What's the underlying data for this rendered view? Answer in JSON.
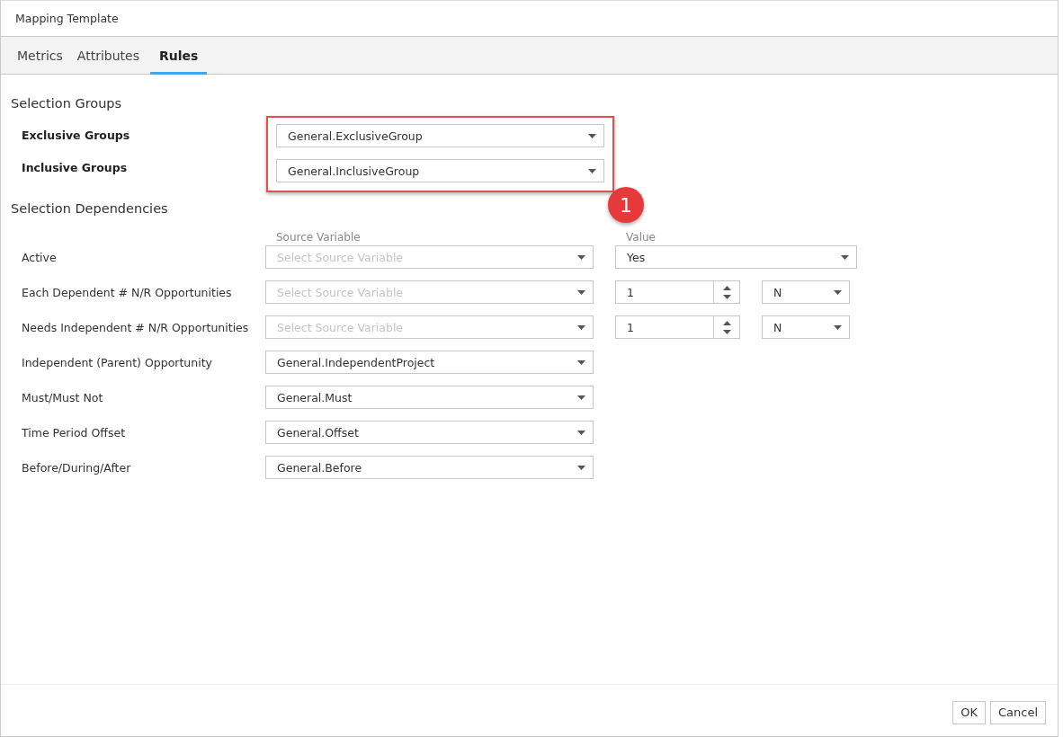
{
  "window": {
    "title": "Mapping Template"
  },
  "tabs": [
    {
      "label": "Metrics",
      "selected": false
    },
    {
      "label": "Attributes",
      "selected": false
    },
    {
      "label": "Rules",
      "selected": true
    }
  ],
  "selection_groups": {
    "heading": "Selection Groups",
    "callout": "1",
    "rows": [
      {
        "label": "Exclusive Groups",
        "value": "General.ExclusiveGroup"
      },
      {
        "label": "Inclusive Groups",
        "value": "General.InclusiveGroup"
      }
    ]
  },
  "selection_dependencies": {
    "heading": "Selection Dependencies",
    "column_headers": {
      "source": "Source Variable",
      "value": "Value"
    },
    "rows": [
      {
        "kind": "select-value",
        "label": "Active",
        "source_placeholder": "Select Source Variable",
        "value": "Yes"
      },
      {
        "kind": "spin-unit",
        "label": "Each Dependent # N/R Opportunities",
        "source_placeholder": "Select Source Variable",
        "number": "1",
        "unit": "N"
      },
      {
        "kind": "spin-unit",
        "label": "Needs Independent # N/R Opportunities",
        "source_placeholder": "Select Source Variable",
        "number": "1",
        "unit": "N"
      },
      {
        "kind": "source",
        "label": "Independent (Parent) Opportunity",
        "source": "General.IndependentProject"
      },
      {
        "kind": "source",
        "label": "Must/Must Not",
        "source": "General.Must"
      },
      {
        "kind": "source",
        "label": "Time Period Offset",
        "source": "General.Offset"
      },
      {
        "kind": "source",
        "label": "Before/During/After",
        "source": "General.Before"
      }
    ]
  },
  "buttons": [
    {
      "label": "OK"
    },
    {
      "label": "Cancel"
    }
  ]
}
